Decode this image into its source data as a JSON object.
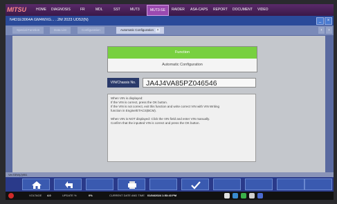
{
  "menubar": {
    "brand": "MITSU",
    "items": [
      "HOME",
      "DIAGNOSIS",
      "FR",
      "MDL",
      "SST",
      "MUT3",
      "MUT3-SE",
      "RAIDER",
      "ASA-CAPS",
      "REPORT",
      "DOCUMENT",
      "VIDEO"
    ],
    "active_index": 6
  },
  "titlebar": {
    "text": "N4D1E3064A  GM4WXG...  ..2M 2023  UD52(N)",
    "minimize": "_",
    "close": "×"
  },
  "tabs": [
    "Special Function",
    "Data List",
    "Configuration",
    "Automatic Configuration"
  ],
  "active_tab": 3,
  "function": {
    "header": "Function",
    "name": "Automatic Configuration"
  },
  "vin": {
    "label": "VIN/Chassis No.",
    "value": "JA4J4VA85PZ046546"
  },
  "message": {
    "lines": [
      "When VIN is displayed:",
      "If the VIN is correct, press the OK button.",
      "If the VIN is not correct, exit this function and write correct VIN with VIN Writing",
      "function in Engine/ETACS(BCM).",
      "",
      "When VIN is NOT displayed: Click the VIN field and enter VIN manually.",
      "Confirm that the inputted VIN is correct and press the OK button."
    ]
  },
  "version": "Ver.SEW(J)951",
  "bottom_buttons": [
    "home-icon",
    "back-icon",
    "print-icon",
    "ok-check-icon"
  ],
  "status": {
    "vehicle_voltage_label": "VOLTAGE",
    "vehicle_voltage": "4.0",
    "update_label": "UPDATE %",
    "update_value": "0%",
    "date_label": "CURRENT DATE AND TIME",
    "date_value": "01/04/2024 1:53:43 PM"
  },
  "colors": {
    "function_header": "#78d040",
    "power": "#d02a2a"
  }
}
